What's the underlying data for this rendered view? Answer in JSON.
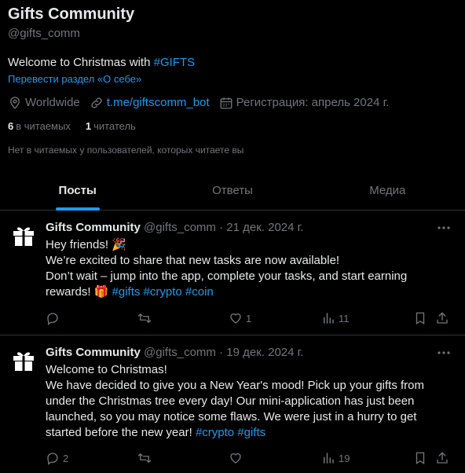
{
  "profile": {
    "name": "Gifts Community",
    "handle": "@gifts_comm",
    "bio_text": "Welcome to Christmas with ",
    "bio_tag": "#GIFTS",
    "translate": "Перевести раздел «О себе»",
    "location": "Worldwide",
    "website": "t.me/giftscomm_bot",
    "joined": "Регистрация: апрель 2024 г.",
    "following_count": "6",
    "following_label": "в читаемых",
    "followers_count": "1",
    "followers_label": "читатель",
    "not_followed": "Нет в читаемых у пользователей, которых читаете вы"
  },
  "tabs": [
    {
      "label": "Посты",
      "active": true
    },
    {
      "label": "Ответы",
      "active": false
    },
    {
      "label": "Медиа",
      "active": false
    }
  ],
  "posts": [
    {
      "name": "Gifts Community",
      "meta": "@gifts_comm · 21 дек. 2024 г.",
      "line1": "Hey friends! 🎉",
      "line2": "We’re excited to share that new tasks are now available!",
      "line3": "Don’t wait – jump into the app, complete your tasks, and start earning",
      "line4": "rewards! 🎁 ",
      "tags": "#gifts #crypto #coin",
      "replies": "",
      "retweets": "",
      "likes": "1",
      "views": "11"
    },
    {
      "name": "Gifts Community",
      "meta": "@gifts_comm · 19 дек. 2024 г.",
      "line1": "Welcome to Christmas!",
      "line2": "We have decided to give you a New Year's mood! Pick up your gifts from",
      "line3": "under the Christmas tree every day! Our mini-application has just been",
      "line4": "launched, so you may notice some flaws. We were just in a hurry to get",
      "line5": "started before the new year! ",
      "tags": "#crypto #gifts",
      "replies": "2",
      "retweets": "",
      "likes": "",
      "views": "19"
    }
  ]
}
